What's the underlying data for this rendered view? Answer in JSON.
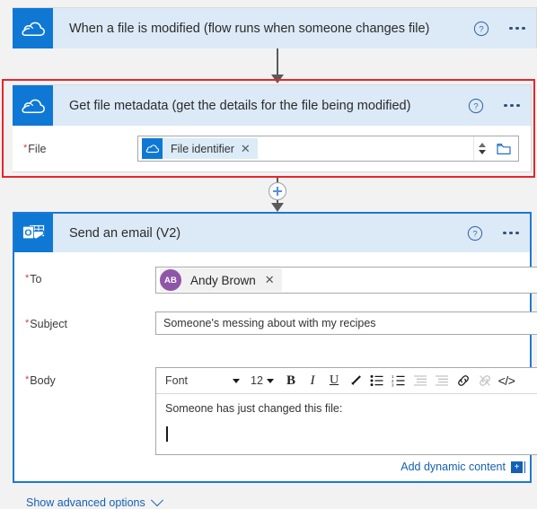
{
  "flow": {
    "cards": [
      {
        "id": "trigger",
        "icon": "onedrive-cloud-icon",
        "title": "When a file is modified (flow runs when someone changes file)",
        "help_label": "?",
        "menu_label": "•••"
      },
      {
        "id": "metadata",
        "icon": "onedrive-cloud-icon",
        "title": "Get file metadata (get the details for the file being modified)",
        "help_label": "?",
        "menu_label": "•••",
        "fields": {
          "file": {
            "label": "File",
            "required_marker": "*",
            "token": {
              "icon": "onedrive-cloud-icon",
              "label": "File identifier",
              "remove_label": "✕"
            },
            "spinner_up": "▲",
            "spinner_down": "▼",
            "browse_icon": "folder-icon"
          }
        }
      },
      {
        "id": "email",
        "icon": "outlook-icon",
        "title": "Send an email (V2)",
        "help_label": "?",
        "menu_label": "•••",
        "fields": {
          "to": {
            "label": "To",
            "required_marker": "*",
            "recipient": {
              "initials": "AB",
              "name": "Andy Brown",
              "remove_label": "✕",
              "avatar_color": "#8f56a8"
            }
          },
          "subject": {
            "label": "Subject",
            "required_marker": "*",
            "value": "Someone's messing about with my recipes"
          },
          "body": {
            "label": "Body",
            "required_marker": "*",
            "value": "Someone has just changed this file:",
            "toolbar": {
              "font_name": "Font",
              "font_size": "12",
              "buttons": [
                {
                  "name": "bold-button",
                  "glyph": "B",
                  "style": "b",
                  "disabled": false
                },
                {
                  "name": "italic-button",
                  "glyph": "I",
                  "style": "i",
                  "disabled": false
                },
                {
                  "name": "underline-button",
                  "glyph": "U",
                  "style": "u",
                  "disabled": false
                },
                {
                  "name": "text-color-button",
                  "glyph": "pen",
                  "style": "svg",
                  "disabled": false
                },
                {
                  "name": "bulleted-list-button",
                  "glyph": "ul",
                  "style": "svg",
                  "disabled": false
                },
                {
                  "name": "numbered-list-button",
                  "glyph": "ol",
                  "style": "svg",
                  "disabled": false
                },
                {
                  "name": "outdent-button",
                  "glyph": "outdent",
                  "style": "svg",
                  "disabled": true
                },
                {
                  "name": "indent-button",
                  "glyph": "indent",
                  "style": "svg",
                  "disabled": true
                },
                {
                  "name": "insert-link-button",
                  "glyph": "link",
                  "style": "svg",
                  "disabled": false
                },
                {
                  "name": "remove-link-button",
                  "glyph": "unlink",
                  "style": "svg",
                  "disabled": true
                },
                {
                  "name": "code-view-button",
                  "glyph": "</>",
                  "style": "code",
                  "disabled": false
                }
              ]
            }
          }
        },
        "add_dynamic_content": "Add dynamic content",
        "add_dynamic_content_badge": "+",
        "show_advanced_options": "Show advanced options"
      }
    ],
    "connectors": {
      "insert_step_label": "+"
    },
    "highlight_color": "#e8252a",
    "accent_color": "#0f78d4",
    "selected_card_border": "#1f78d1"
  }
}
